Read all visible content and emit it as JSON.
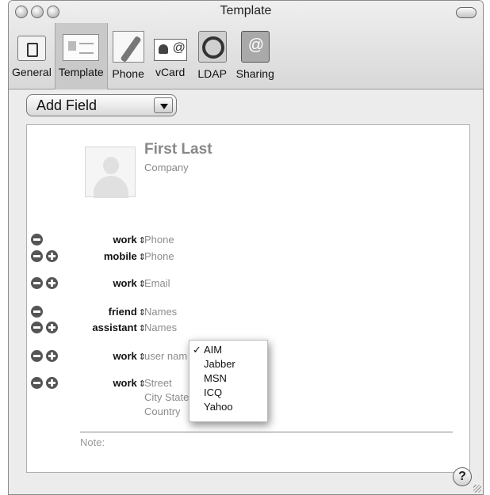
{
  "window": {
    "title": "Template"
  },
  "toolbar": {
    "items": [
      {
        "label": "General",
        "icon": "general-icon",
        "selected": false
      },
      {
        "label": "Template",
        "icon": "template-icon",
        "selected": true
      },
      {
        "label": "Phone",
        "icon": "phone-icon",
        "selected": false
      },
      {
        "label": "vCard",
        "icon": "vcard-icon",
        "selected": false
      },
      {
        "label": "LDAP",
        "icon": "ldap-icon",
        "selected": false
      },
      {
        "label": "Sharing",
        "icon": "sharing-icon",
        "selected": false
      }
    ]
  },
  "add_field": {
    "label": "Add Field"
  },
  "card": {
    "name": "First Last",
    "company": "Company",
    "fields": [
      {
        "label": "work",
        "value": "Phone",
        "minus": true,
        "plus": false
      },
      {
        "label": "mobile",
        "value": "Phone",
        "minus": true,
        "plus": true
      },
      {
        "label": "work",
        "value": "Email",
        "minus": true,
        "plus": true
      },
      {
        "label": "friend",
        "value": "Names",
        "minus": true,
        "plus": false
      },
      {
        "label": "assistant",
        "value": "Names",
        "minus": true,
        "plus": true
      },
      {
        "label": "work",
        "value": "user nam",
        "minus": true,
        "plus": true
      },
      {
        "label": "work",
        "value": "Street",
        "minus": true,
        "plus": true
      }
    ],
    "address_lines": [
      "City State",
      "Country"
    ],
    "note_label": "Note:"
  },
  "im_menu": {
    "options": [
      "AIM",
      "Jabber",
      "MSN",
      "ICQ",
      "Yahoo"
    ],
    "selected": "AIM",
    "check": "✓"
  },
  "help": {
    "label": "?"
  }
}
